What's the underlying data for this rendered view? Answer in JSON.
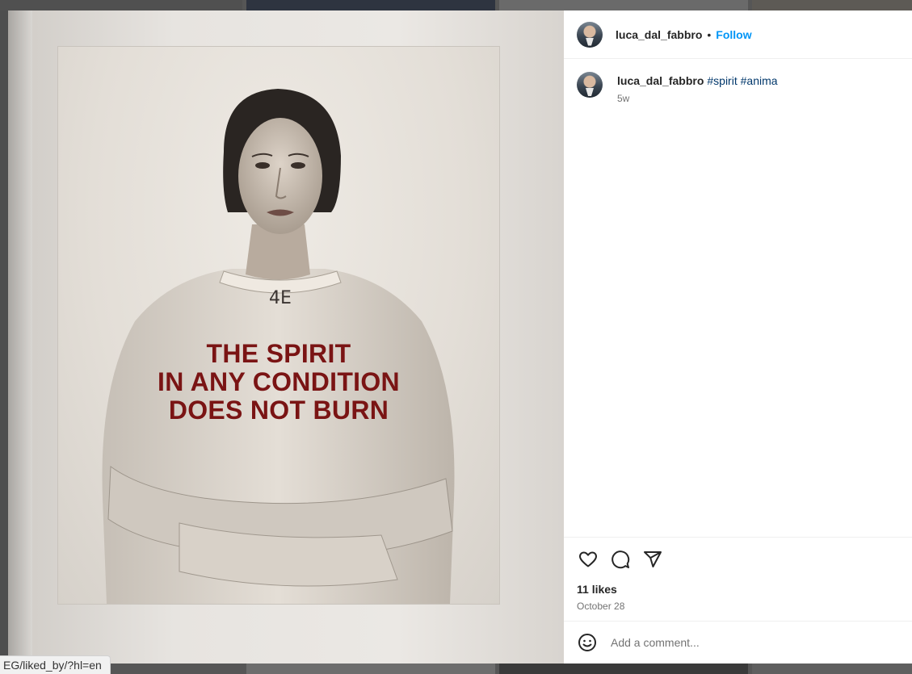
{
  "post": {
    "username": "luca_dal_fabbro",
    "separator": "•",
    "follow_label": "Follow",
    "caption": {
      "username": "luca_dal_fabbro",
      "hashtags": [
        "#spirit",
        "#anima"
      ],
      "relative_time": "5w"
    },
    "likes": "11 likes",
    "date": "October 28",
    "comment_placeholder": "Add a comment..."
  },
  "media": {
    "poster_text": [
      "THE SPIRIT",
      "IN ANY CONDITION",
      "DOES NOT BURN"
    ],
    "shirt_marking": "4E"
  },
  "icons": {
    "like": "heart-icon",
    "comment": "comment-bubble-icon",
    "share": "paper-plane-icon",
    "emoji": "smiley-icon"
  },
  "colors": {
    "follow_blue": "#0095f6",
    "hashtag": "#00376b",
    "poster_text": "#7a1414"
  },
  "status_bar": {
    "url": "EG/liked_by/?hl=en"
  }
}
